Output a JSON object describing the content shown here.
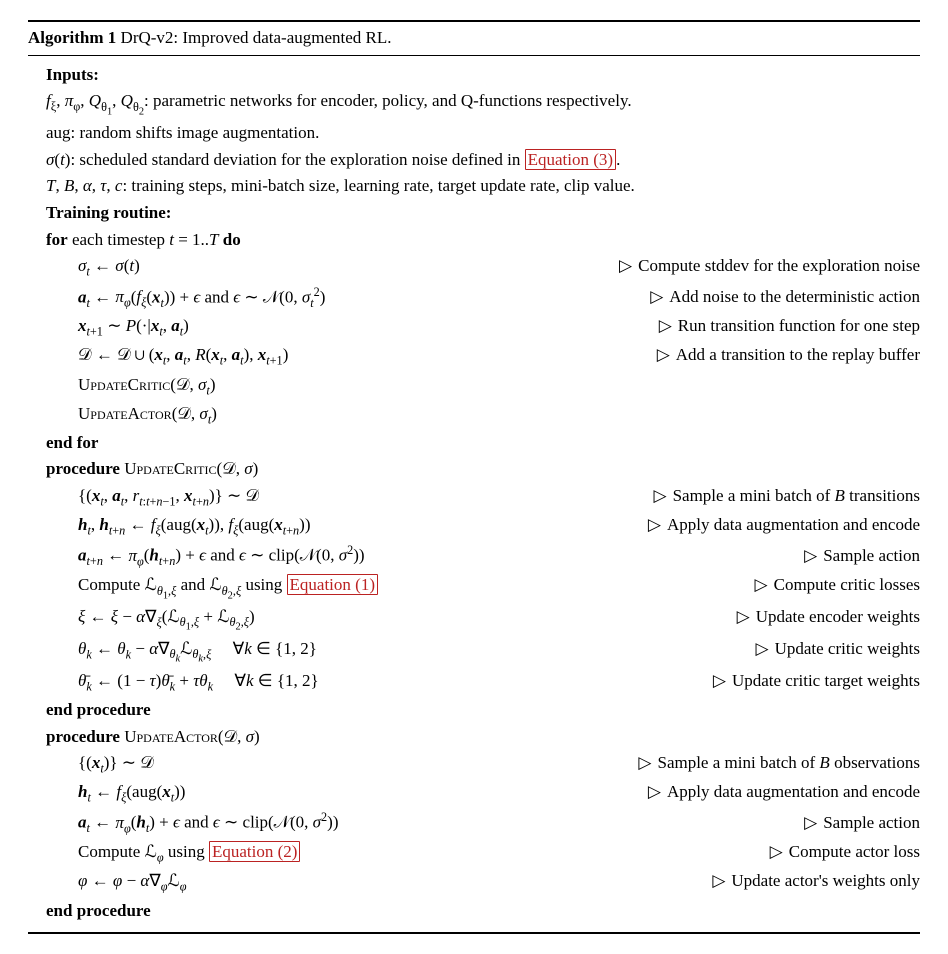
{
  "title_prefix": "Algorithm 1",
  "title_text": " DrQ-v2: Improved data-augmented RL.",
  "inputs_header": "Inputs:",
  "inputs": {
    "networks": "fξ, πφ, Qθ₁, Qθ₂: parametric networks for encoder, policy, and Q-functions respectively.",
    "aug": "aug: random shifts image augmentation.",
    "sigma_pre": "σ(t): scheduled standard deviation for the exploration noise defined in ",
    "sigma_ref": "Equation (3)",
    "sigma_post": ".",
    "hyper": "T, B, α, τ, c: training steps, mini-batch size, learning rate, target update rate, clip value."
  },
  "training_header": "Training routine:",
  "for_line": "for each timestep t = 1..T do",
  "end_for": "end for",
  "end_proc": "end procedure",
  "proc_critic": "procedure UpdateCritic(𝒟, σ)",
  "proc_actor": "procedure UpdateActor(𝒟, σ)",
  "steps": {
    "sigma_t": {
      "l": "σt ← σ(t)",
      "r": "Compute stddev for the exploration noise"
    },
    "a_t": {
      "l": "𝒂t ← πφ(fξ(𝒙t)) + ϵ and ϵ ∼ 𝒩(0, σt²)",
      "r": "Add noise to the deterministic action"
    },
    "x_t1": {
      "l": "𝒙t+1 ∼ P(·|𝒙t, 𝒂t)",
      "r": "Run transition function for one step"
    },
    "D": {
      "l": "𝒟 ← 𝒟 ∪ (𝒙t, 𝒂t, R(𝒙t, 𝒂t), 𝒙t+1)",
      "r": "Add a transition to the replay buffer"
    },
    "upd_crit": {
      "l": "UpdateCritic(𝒟, σt)"
    },
    "upd_act": {
      "l": "UpdateActor(𝒟, σt)"
    }
  },
  "critic": {
    "sample": {
      "l": "{(𝒙t, 𝒂t, rt:t+n−1, 𝒙t+n)} ∼ 𝒟",
      "r": "Sample a mini batch of B transitions"
    },
    "encode": {
      "l": "𝒉t, 𝒉t+n ← fξ(aug(𝒙t)), fξ(aug(𝒙t+n))",
      "r": "Apply data augmentation and encode"
    },
    "action": {
      "l": "𝒂t+n ← πφ(𝒉t+n) + ϵ and ϵ ∼ clip(𝒩(0, σ²))",
      "r": "Sample action"
    },
    "loss_pre": "Compute ℒθ₁,ξ and ℒθ₂,ξ using ",
    "loss_ref": "Equation (1)",
    "loss_r": "Compute critic losses",
    "upd_enc": {
      "l": "ξ ← ξ − α∇ξ(ℒθ₁,ξ + ℒθ₂,ξ)",
      "r": "Update encoder weights"
    },
    "upd_crit": {
      "l": "θk ← θk − α∇θk ℒθk,ξ    ∀k ∈ {1, 2}",
      "r": "Update critic weights"
    },
    "upd_tgt": {
      "l": "θ̄k ← (1 − τ)θ̄k + τθk    ∀k ∈ {1, 2}",
      "r": "Update critic target weights"
    }
  },
  "actor": {
    "sample": {
      "l": "{(𝒙t)} ∼ 𝒟",
      "r": "Sample a mini batch of B observations"
    },
    "encode": {
      "l": "𝒉t ← fξ(aug(𝒙t))",
      "r": "Apply data augmentation and encode"
    },
    "action": {
      "l": "𝒂t ← πφ(𝒉t) + ϵ and ϵ ∼ clip(𝒩(0, σ²))",
      "r": "Sample action"
    },
    "loss_pre": "Compute ℒφ using ",
    "loss_ref": "Equation (2)",
    "loss_r": "Compute actor loss",
    "upd": {
      "l": "φ ← φ − α∇φℒφ",
      "r": "Update actor's weights only"
    }
  }
}
